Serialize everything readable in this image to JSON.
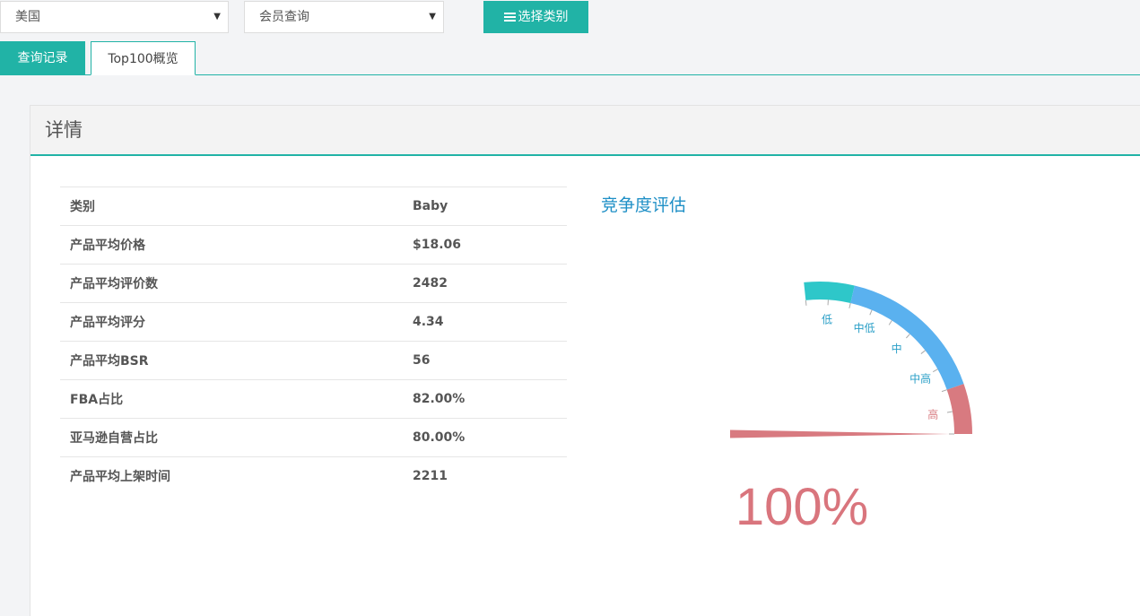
{
  "toolbar": {
    "country": "美国",
    "query_type": "会员查询",
    "category_button": "选择类别"
  },
  "tabs": [
    {
      "label": "查询记录",
      "active": false
    },
    {
      "label": "Top100概览",
      "active": true
    }
  ],
  "panel": {
    "title": "详情",
    "rows": [
      {
        "label": "类别",
        "value": "Baby"
      },
      {
        "label": "产品平均价格",
        "value": "$18.06"
      },
      {
        "label": "产品平均评价数",
        "value": "2482"
      },
      {
        "label": "产品平均评分",
        "value": "4.34"
      },
      {
        "label": "产品平均BSR",
        "value": "56"
      },
      {
        "label": "FBA占比",
        "value": "82.00%"
      },
      {
        "label": "亚马逊自营占比",
        "value": "80.00%"
      },
      {
        "label": "产品平均上架时间",
        "value": "2211"
      }
    ]
  },
  "gauge": {
    "title": "竞争度评估",
    "value": 100,
    "value_text": "100%",
    "labels": [
      "低",
      "中低",
      "中",
      "中高",
      "高"
    ],
    "colors": {
      "low": "#2ec7c9",
      "mid": "#5ab1ef",
      "high": "#d87a80"
    }
  },
  "colors": {
    "accent": "#21b3a6",
    "gauge_title": "#1e8fc6"
  }
}
